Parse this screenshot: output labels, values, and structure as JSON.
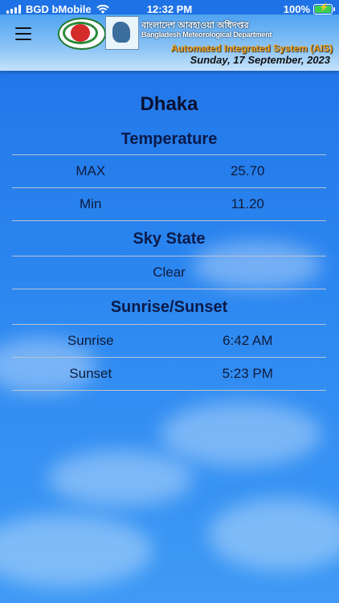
{
  "status_bar": {
    "carrier": "BGD bMobile",
    "time": "12:32 PM",
    "battery": "100%",
    "battery_level": 1.0
  },
  "header": {
    "dept_bangla": "বাংলাদেশ আবহাওয়া অধিদপ্তর",
    "dept_english": "Bangladesh Meteorological Department",
    "system_name": "Automated Integrated System (AIS)",
    "date": "Sunday, 17 September, 2023"
  },
  "main": {
    "city": "Dhaka",
    "temperature": {
      "title": "Temperature",
      "rows": [
        {
          "label": "MAX",
          "value": "25.70"
        },
        {
          "label": "Min",
          "value": "11.20"
        }
      ]
    },
    "sky_state": {
      "title": "Sky State",
      "value": "Clear"
    },
    "sun": {
      "title": "Sunrise/Sunset",
      "rows": [
        {
          "label": "Sunrise",
          "value": "6:42 AM"
        },
        {
          "label": "Sunset",
          "value": "5:23 PM"
        }
      ]
    }
  }
}
